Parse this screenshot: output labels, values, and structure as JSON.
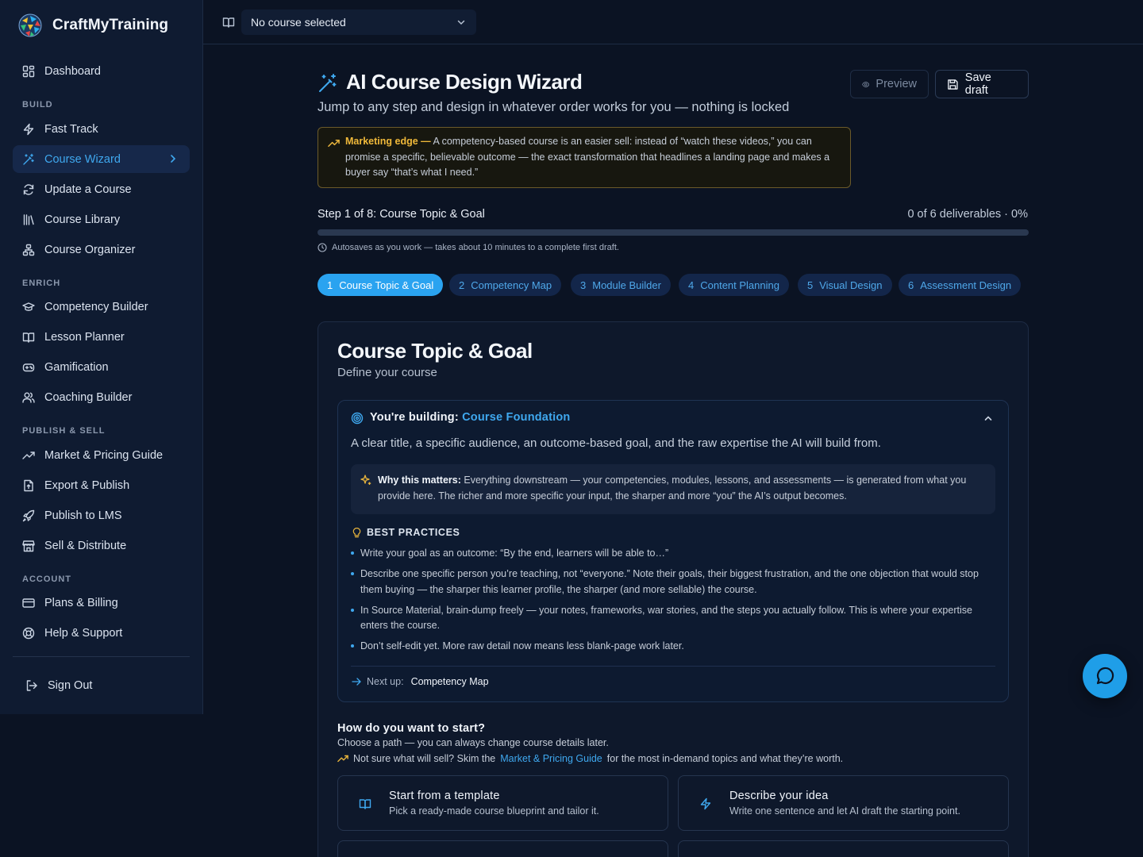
{
  "brand": {
    "name": "CraftMyTraining"
  },
  "sidebar": {
    "dashboard": "Dashboard",
    "sections": {
      "build": "BUILD",
      "enrich": "ENRICH",
      "publish": "PUBLISH & SELL",
      "account": "ACCOUNT"
    },
    "build_items": [
      "Fast Track",
      "Course Wizard",
      "Update a Course",
      "Course Library",
      "Course Organizer"
    ],
    "enrich_items": [
      "Competency Builder",
      "Lesson Planner",
      "Gamification",
      "Coaching Builder"
    ],
    "publish_items": [
      "Market & Pricing Guide",
      "Export & Publish",
      "Publish to LMS",
      "Sell & Distribute"
    ],
    "account_items": [
      "Plans & Billing",
      "Help & Support"
    ],
    "sign_out": "Sign Out",
    "active_item": "Course Wizard"
  },
  "topbar": {
    "course_select_value": "No course selected"
  },
  "header": {
    "title": "AI Course Design Wizard",
    "subtitle": "Jump to any step and design in whatever order works for you — nothing is locked",
    "preview_label": "Preview",
    "save_label": "Save draft"
  },
  "marketing_edge": {
    "label": "Marketing edge —",
    "text": "A competency-based course is an easier sell: instead of “watch these videos,” you can promise a specific, believable outcome — the exact transformation that headlines a landing page and makes a buyer say “that’s what I need.”"
  },
  "progress": {
    "step_label": "Step 1 of 8: Course Topic & Goal",
    "deliverables": "0 of 6 deliverables · 0%",
    "percent": 0,
    "autosave": "Autosaves as you work — takes about 10 minutes to a complete first draft."
  },
  "steps": [
    {
      "num": "1",
      "label": "Course Topic & Goal",
      "active": true
    },
    {
      "num": "2",
      "label": "Competency Map",
      "active": false
    },
    {
      "num": "3",
      "label": "Module Builder",
      "active": false
    },
    {
      "num": "4",
      "label": "Content Planning",
      "active": false
    },
    {
      "num": "5",
      "label": "Visual Design",
      "active": false
    },
    {
      "num": "6",
      "label": "Assessment Design",
      "active": false
    }
  ],
  "card": {
    "title": "Course Topic & Goal",
    "subtitle": "Define your course",
    "building_prefix": "You're building:",
    "building_value": "Course Foundation",
    "description": "A clear title, a specific audience, an outcome-based goal, and the raw expertise the AI will build from.",
    "why_label": "Why this matters:",
    "why_text": "Everything downstream — your competencies, modules, lessons, and assessments — is generated from what you provide here. The richer and more specific your input, the sharper and more “you” the AI’s output becomes.",
    "best_practices_title": "BEST PRACTICES",
    "best_practices": [
      "Write your goal as an outcome: “By the end, learners will be able to…”",
      "Describe one specific person you’re teaching, not “everyone.” Note their goals, their biggest frustration, and the one objection that would stop them buying — the sharper this learner profile, the sharper (and more sellable) the course.",
      "In Source Material, brain-dump freely — your notes, frameworks, war stories, and the steps you actually follow. This is where your expertise enters the course.",
      "Don’t self-edit yet. More raw detail now means less blank-page work later."
    ],
    "next_label": "Next up:",
    "next_value": "Competency Map"
  },
  "start": {
    "heading": "How do you want to start?",
    "subtext": "Choose a path — you can always change course details later.",
    "hint_prefix": "Not sure what will sell? Skim the",
    "hint_link": "Market & Pricing Guide",
    "hint_suffix": "for the most in-demand topics and what they’re worth.",
    "options": [
      {
        "title": "Start from a template",
        "desc": "Pick a ready-made course blueprint and tailor it.",
        "icon": "book-icon"
      },
      {
        "title": "Describe your idea",
        "desc": "Write one sentence and let AI draft the starting point.",
        "icon": "zap-icon"
      }
    ]
  },
  "colors": {
    "accent": "#2aa3f0",
    "warning": "#e8b43c",
    "background": "#0b1323",
    "sidebar": "#0f1b31"
  }
}
